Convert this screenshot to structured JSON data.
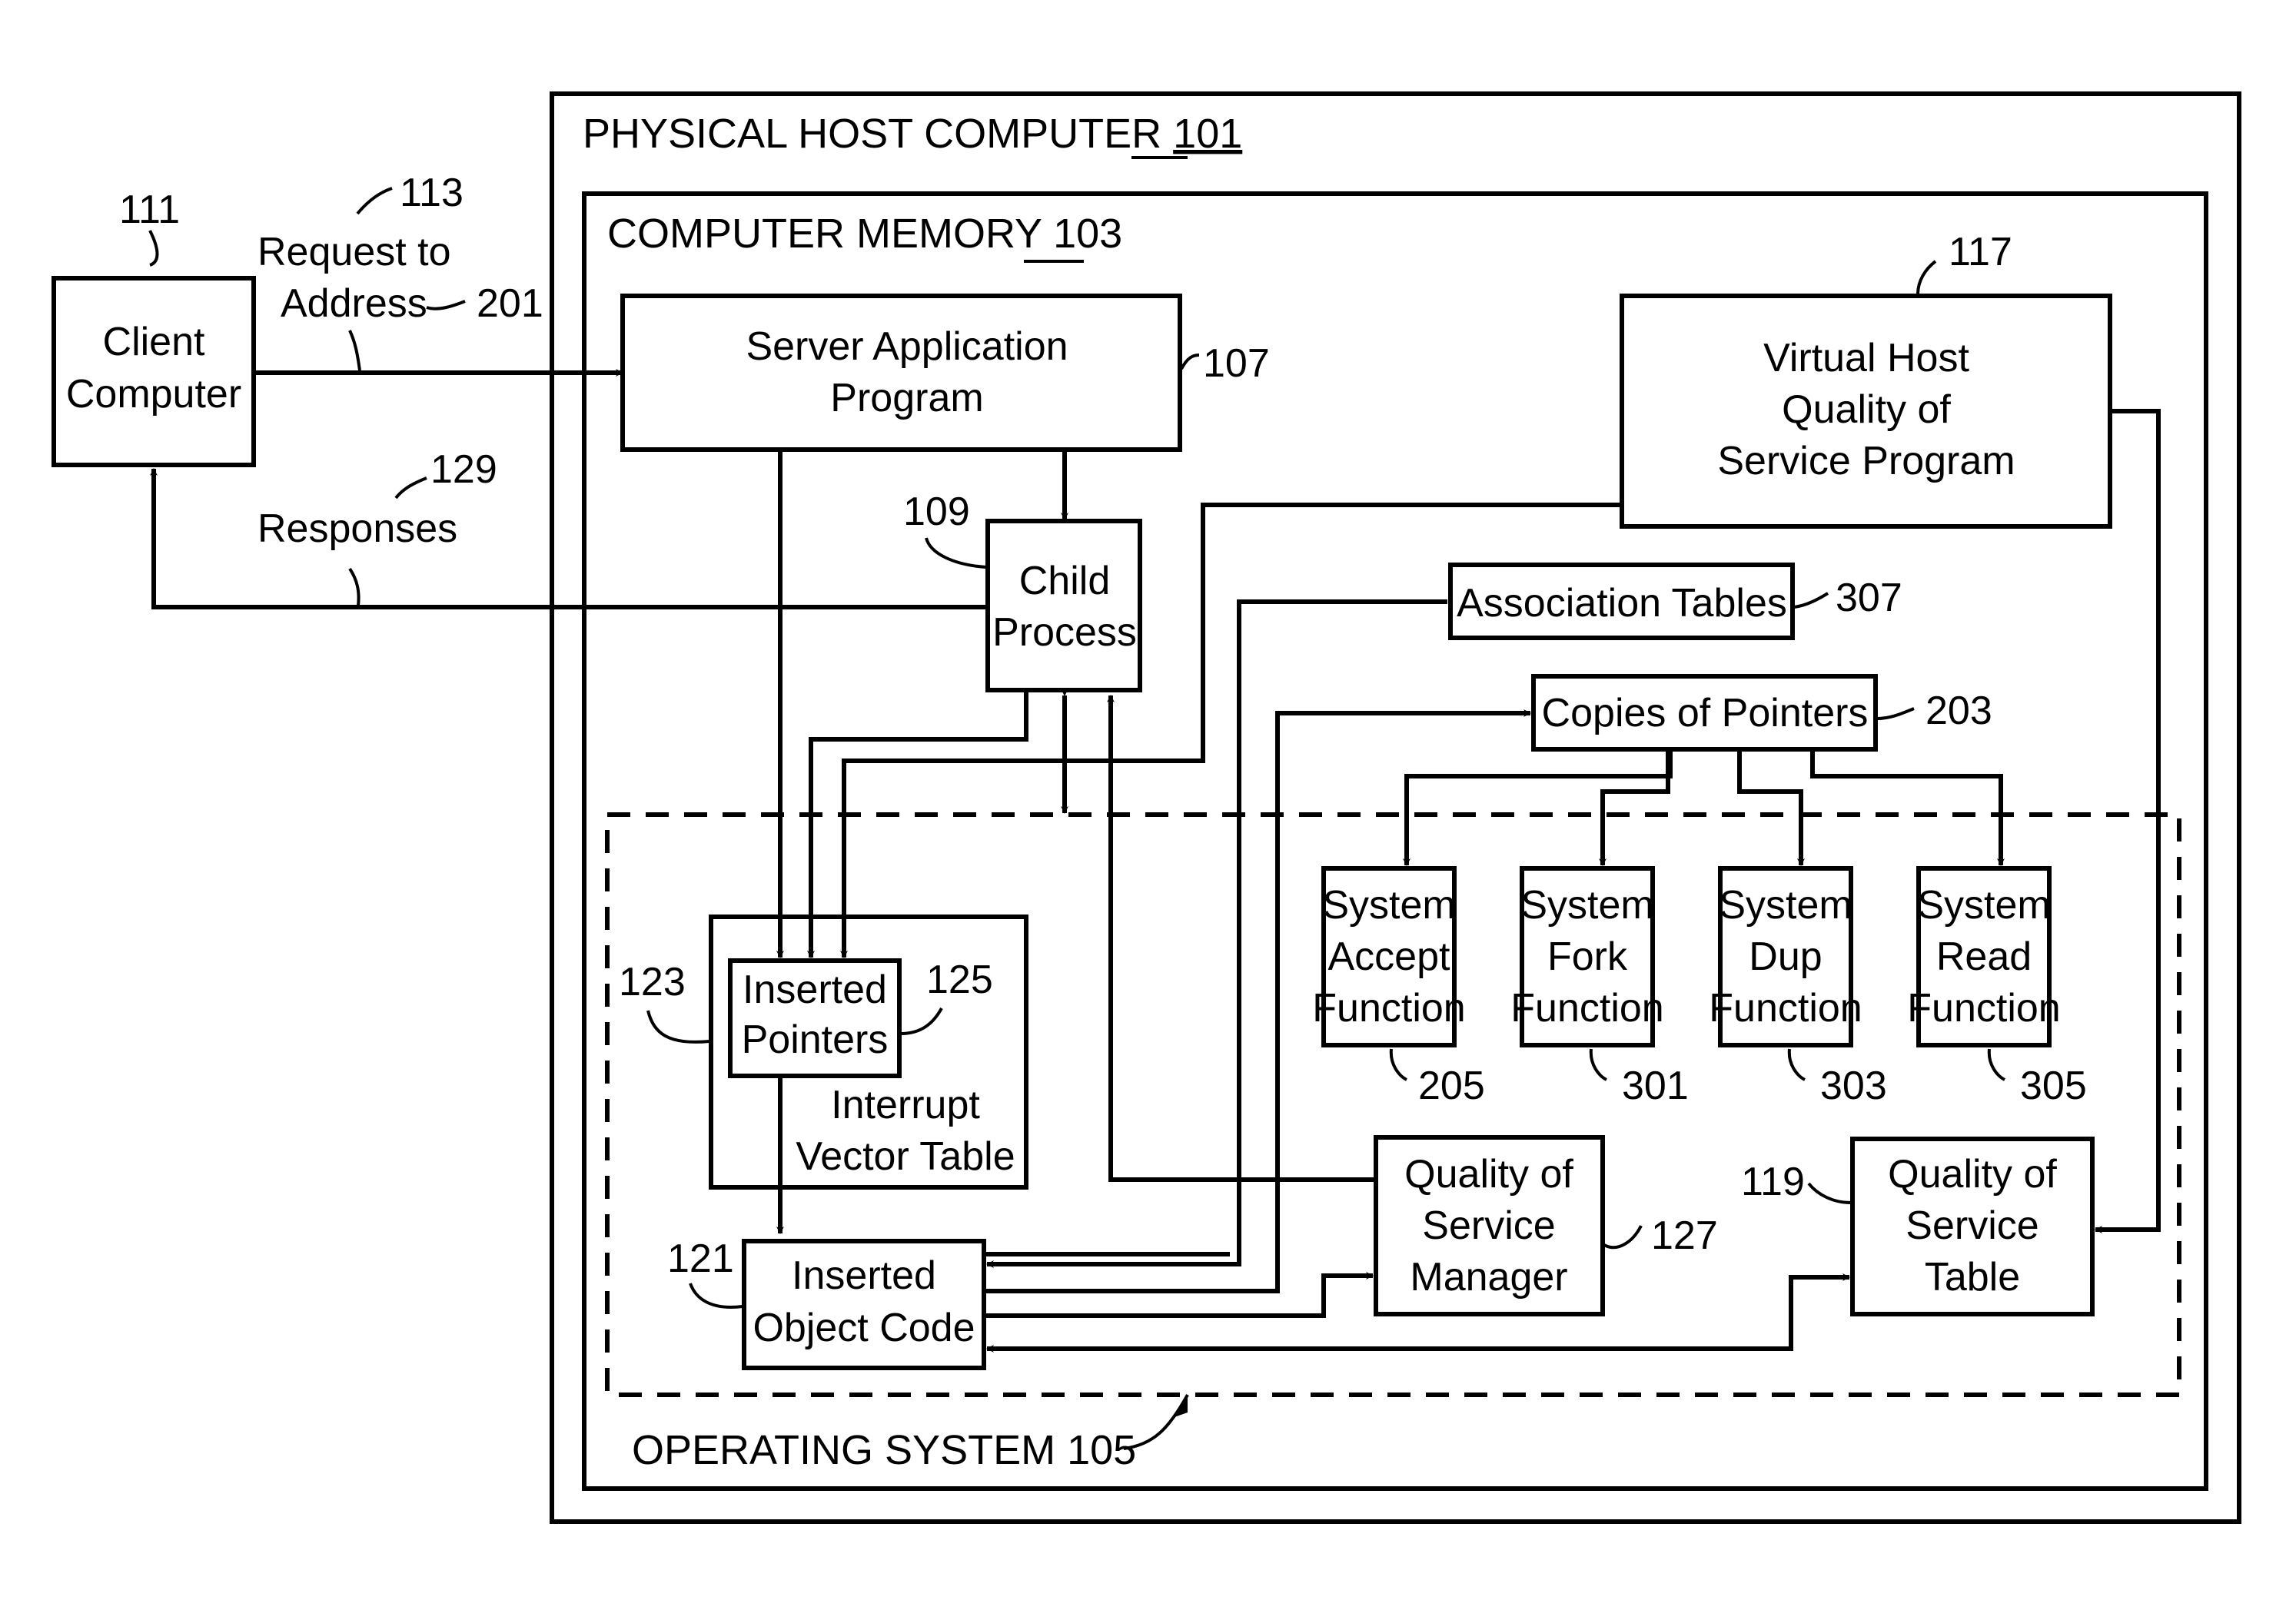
{
  "figure": {
    "physical_host": {
      "label": "PHYSICAL HOST COMPUTER",
      "ref": "101"
    },
    "computer_memory": {
      "label": "COMPUTER MEMORY",
      "ref": "103"
    },
    "operating_system": {
      "label": "OPERATING SYSTEM",
      "ref": "105"
    },
    "client_computer": {
      "lines": [
        "Client",
        "Computer"
      ],
      "ref": "111"
    },
    "request": {
      "lines": [
        "Request to",
        "Address"
      ],
      "ref": "113",
      "ref2": "201"
    },
    "responses": {
      "label": "Responses",
      "ref": "129"
    },
    "server_app": {
      "lines": [
        "Server Application",
        "Program"
      ],
      "ref": "107"
    },
    "child_process": {
      "lines": [
        "Child",
        "Process"
      ],
      "ref": "109"
    },
    "virtual_host_qos": {
      "lines": [
        "Virtual Host",
        "Quality of",
        "Service Program"
      ],
      "ref": "117"
    },
    "association_tables": {
      "label": "Association Tables",
      "ref": "307"
    },
    "copies_of_pointers": {
      "label": "Copies of Pointers",
      "ref": "203"
    },
    "system_accept": {
      "lines": [
        "System",
        "Accept",
        "Function"
      ],
      "ref": "205"
    },
    "system_fork": {
      "lines": [
        "System",
        "Fork",
        "Function"
      ],
      "ref": "301"
    },
    "system_dup": {
      "lines": [
        "System",
        "Dup",
        "Function"
      ],
      "ref": "303"
    },
    "system_read": {
      "lines": [
        "System",
        "Read",
        "Function"
      ],
      "ref": "305"
    },
    "interrupt_vector_table": {
      "lines": [
        "Interrupt",
        "Vector Table"
      ],
      "ref": "123"
    },
    "inserted_pointers": {
      "lines": [
        "Inserted",
        "Pointers"
      ],
      "ref": "125"
    },
    "inserted_object_code": {
      "lines": [
        "Inserted",
        "Object Code"
      ],
      "ref": "121"
    },
    "qos_manager": {
      "lines": [
        "Quality of",
        "Service",
        "Manager"
      ],
      "ref": "127"
    },
    "qos_table": {
      "lines": [
        "Quality of",
        "Service",
        "Table"
      ],
      "ref": "119"
    }
  }
}
